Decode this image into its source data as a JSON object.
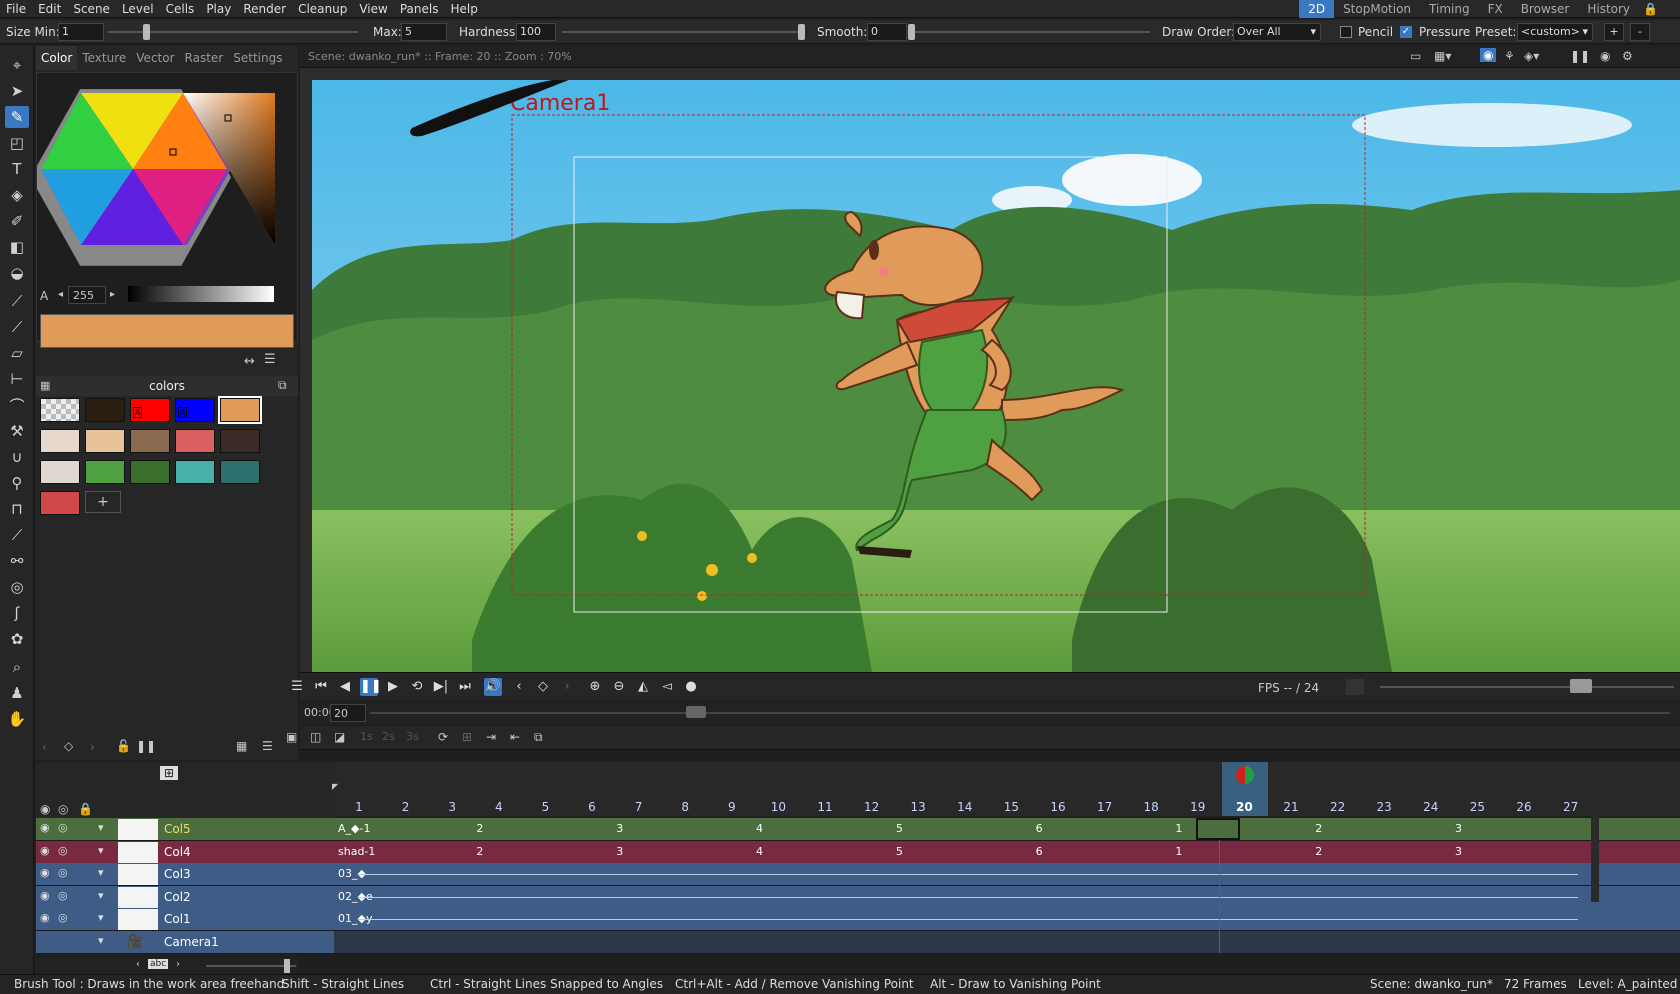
{
  "menu": [
    "File",
    "Edit",
    "Scene",
    "Level",
    "Cells",
    "Play",
    "Render",
    "Cleanup",
    "View",
    "Panels",
    "Help"
  ],
  "rooms": [
    {
      "label": "2D",
      "active": true
    },
    {
      "label": "StopMotion"
    },
    {
      "label": "Timing"
    },
    {
      "label": "FX"
    },
    {
      "label": "Browser"
    },
    {
      "label": "History"
    }
  ],
  "tool_options": {
    "size_min_label": "Size Min:",
    "size_min": "1",
    "max_label": "Max:",
    "max": "5",
    "hardness_label": "Hardness:",
    "hardness": "100",
    "smooth_label": "Smooth:",
    "smooth": "0",
    "draw_order_label": "Draw Order:",
    "draw_order": "Over All",
    "pencil_label": "Pencil",
    "pressure_label": "Pressure",
    "preset_label": "Preset:",
    "preset": "<custom>",
    "plus": "+",
    "minus": "-"
  },
  "style_tabs": [
    "Color",
    "Texture",
    "Vector",
    "Raster",
    "Settings"
  ],
  "alpha": {
    "label": "A",
    "value": "255"
  },
  "current_color": "#e09a5a",
  "palette": {
    "title": "colors",
    "chips": [
      {
        "color": "checker",
        "sel": false
      },
      {
        "color": "#2a1e12"
      },
      {
        "color": "#ff0000",
        "tag": "A"
      },
      {
        "color": "#0000ff",
        "tag": "A"
      },
      {
        "color": "#e09a5a",
        "sel": true
      },
      {
        "color": "#e6d8cc"
      },
      {
        "color": "#e8c29a"
      },
      {
        "color": "#8c6a50"
      },
      {
        "color": "#d86060"
      },
      {
        "color": "#3a2a28"
      },
      {
        "color": "#e0d8d0"
      },
      {
        "color": "#4ea040"
      },
      {
        "color": "#3a6e2a"
      },
      {
        "color": "#48b0a8"
      },
      {
        "color": "#2e7070"
      },
      {
        "color": "#d04848"
      }
    ],
    "add": "+"
  },
  "viewer": {
    "info": "Scene: dwanko_run*  ::  Frame: 20  ::  Zoom : 70%",
    "camera_label": "Camera1"
  },
  "playback": {
    "fps_label": "FPS -- / 24",
    "time": "00:00:20",
    "frame": "20"
  },
  "xsheet": {
    "frames": [
      "1",
      "2",
      "3",
      "4",
      "5",
      "6",
      "7",
      "8",
      "9",
      "10",
      "11",
      "12",
      "13",
      "14",
      "15",
      "16",
      "17",
      "18",
      "19",
      "20",
      "21",
      "22",
      "23",
      "24",
      "25",
      "26",
      "27"
    ],
    "current_frame": "20",
    "columns": [
      {
        "name": "Col5",
        "color": "#4c6e3e",
        "namecolor": "#e8e060",
        "cells": [
          "A_",
          {
            "t": "2"
          },
          {
            "t": "3"
          },
          {
            "t": "4"
          },
          {
            "t": "5"
          },
          {
            "t": "6"
          },
          {
            "t": "1"
          },
          {
            "t": "2"
          },
          {
            "t": "3"
          }
        ],
        "first": "A_◆-1"
      },
      {
        "name": "Col4",
        "color": "#7a2a40",
        "namecolor": "#ffffff",
        "first": "shad-1"
      },
      {
        "name": "Col3",
        "color": "#3e5c86",
        "namecolor": "#ffffff",
        "first": "03_◆"
      },
      {
        "name": "Col2",
        "color": "#3e5c86",
        "namecolor": "#ffffff",
        "first": "02_◆e"
      },
      {
        "name": "Col1",
        "color": "#3e5c86",
        "namecolor": "#ffffff",
        "first": "01_◆y"
      },
      {
        "name": "Camera1",
        "color": "#3e5c86",
        "namecolor": "#ffffff",
        "first": ""
      }
    ],
    "seq_labels": [
      "2",
      "3",
      "4",
      "5",
      "6",
      "1",
      "2",
      "3"
    ]
  },
  "status": {
    "tool": "Brush Tool : Draws in the work area freehand",
    "shift": "Shift - Straight Lines",
    "ctrl": "Ctrl - Straight Lines Snapped to Angles",
    "ctrlalt": "Ctrl+Alt - Add / Remove Vanishing Point",
    "alt": "Alt - Draw to Vanishing Point",
    "scene": "Scene: dwanko_run*",
    "frames": "72 Frames",
    "level": "Level: A_painted"
  }
}
